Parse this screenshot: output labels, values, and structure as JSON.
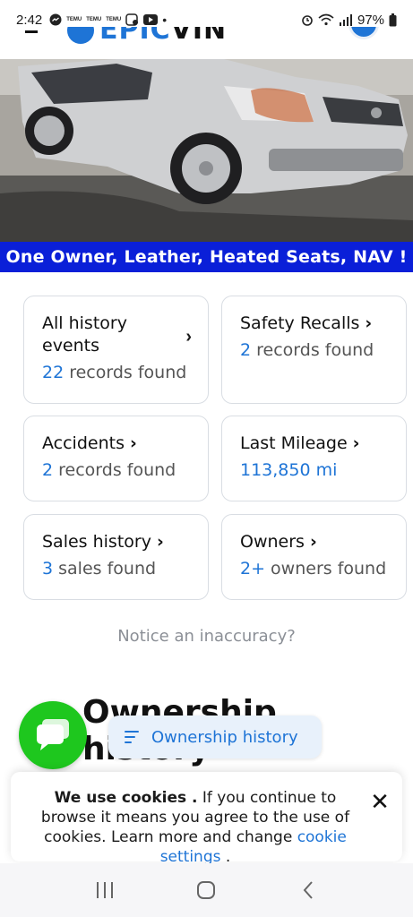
{
  "status_bar": {
    "time": "2:42",
    "notif_labels": [
      "TEMU",
      "TEMU",
      "TEMU"
    ],
    "battery": "97%"
  },
  "header": {
    "logo_prefix": "EPIC",
    "logo_suffix": "VIN"
  },
  "banner": {
    "text": "One Owner, Leather, Heated Seats, NAV !"
  },
  "cards": {
    "all_history": {
      "title": "All history events",
      "count": "22",
      "suffix": " records found"
    },
    "safety_recalls": {
      "title": "Safety Recalls",
      "count": "2",
      "suffix": " records found"
    },
    "accidents": {
      "title": "Accidents",
      "count": "2",
      "suffix": " records found"
    },
    "last_mileage": {
      "title": "Last Mileage",
      "value": "113,850 mi"
    },
    "sales_history": {
      "title": "Sales history",
      "count": "3",
      "suffix": " sales found"
    },
    "owners": {
      "title": "Owners",
      "count": "2+",
      "suffix": " owners found"
    }
  },
  "notice": "Notice an inaccuracy?",
  "section_title": "Ownership history",
  "pill_label": "Ownership history",
  "cookie": {
    "bold": "We use cookies .",
    "text": " If you continue to browse it means you agree to the use of cookies. Learn more and change ",
    "link": "cookie settings",
    "end": " ."
  },
  "colors": {
    "accent": "#1e74d6",
    "banner_bg": "#0a1fd8",
    "chat_fab": "#1ec71e"
  }
}
